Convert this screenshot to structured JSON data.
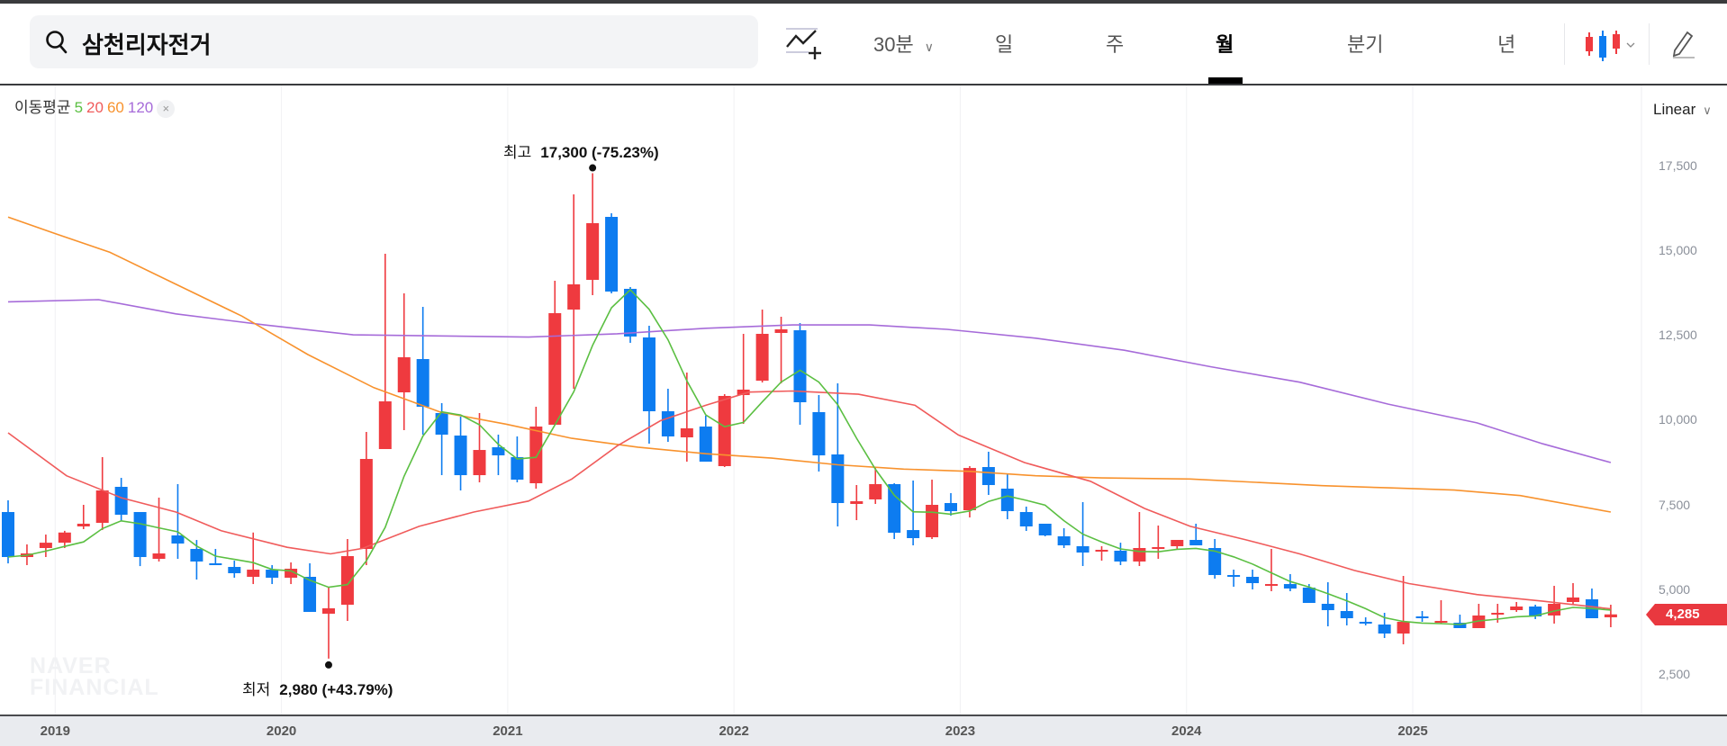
{
  "search": {
    "query": "삼천리자전거"
  },
  "toolbar": {
    "interval": "30분",
    "chevron": "⌄",
    "periods": [
      "일",
      "주",
      "월",
      "분기",
      "년"
    ],
    "active_period": "월"
  },
  "legend": {
    "label": "이동평균",
    "ma5": "5",
    "ma20": "20",
    "ma60": "60",
    "ma120": "120",
    "close": "×"
  },
  "scale": {
    "label": "Linear",
    "chevron": "⌄"
  },
  "annotations": {
    "high_label": "최고",
    "high_value": "17,300 (-75.23%)",
    "low_label": "최저",
    "low_value": "2,980 (+43.79%)"
  },
  "watermark": "NAVER FINANCIAL",
  "current_price": "4,285",
  "colors": {
    "up": "#ef3a3f",
    "down": "#0d7cf0",
    "ma5": "#5bbf42",
    "ma20": "#f05b5b",
    "ma60": "#f8922d",
    "ma120": "#a66bd9"
  },
  "chart_data": {
    "type": "candlestick",
    "interval": "monthly",
    "y_ticks": [
      "17,500",
      "15,000",
      "12,500",
      "10,000",
      "7,500",
      "5,000",
      "2,500"
    ],
    "y_tick_values": [
      17500,
      15000,
      12500,
      10000,
      7500,
      5000,
      2500
    ],
    "x_ticks": [
      {
        "label": "2019",
        "month": "2019-01"
      },
      {
        "label": "2020",
        "month": "2020-01"
      },
      {
        "label": "2021",
        "month": "2021-01"
      },
      {
        "label": "2022",
        "month": "2022-01"
      },
      {
        "label": "2023",
        "month": "2023-01"
      },
      {
        "label": "2024",
        "month": "2024-01"
      },
      {
        "label": "2025",
        "month": "2025-01"
      }
    ],
    "candle_fields": [
      "month",
      "open",
      "high",
      "low",
      "close"
    ],
    "candles": [
      [
        "2018-10",
        7305,
        7650,
        5790,
        5977
      ],
      [
        "2018-11",
        5977,
        6350,
        5738,
        6083
      ],
      [
        "2018-12",
        6243,
        6640,
        5977,
        6400
      ],
      [
        "2019-01",
        6400,
        6750,
        6243,
        6700
      ],
      [
        "2019-02",
        6880,
        7517,
        6800,
        6960
      ],
      [
        "2019-03",
        6986,
        8924,
        6773,
        7942
      ],
      [
        "2019-04",
        8048,
        8313,
        7040,
        7225
      ],
      [
        "2019-05",
        7305,
        7305,
        5710,
        5977
      ],
      [
        "2019-06",
        5924,
        7730,
        5845,
        6083
      ],
      [
        "2019-07",
        6615,
        8128,
        5924,
        6375
      ],
      [
        "2019-08",
        6216,
        6480,
        5313,
        5845
      ],
      [
        "2019-09",
        5792,
        6216,
        5738,
        5738
      ],
      [
        "2019-10",
        5685,
        5870,
        5367,
        5500
      ],
      [
        "2019-11",
        5393,
        6700,
        5180,
        5605
      ],
      [
        "2019-12",
        5605,
        5738,
        5180,
        5367
      ],
      [
        "2020-01",
        5367,
        5818,
        5180,
        5632
      ],
      [
        "2020-02",
        5393,
        5792,
        4358,
        4358
      ],
      [
        "2020-03",
        4305,
        5100,
        2980,
        4464
      ],
      [
        "2020-04",
        4570,
        6508,
        4092,
        6004
      ],
      [
        "2020-05",
        6216,
        9668,
        5738,
        8871
      ],
      [
        "2020-06",
        9163,
        14925,
        9163,
        10570
      ],
      [
        "2020-07",
        10836,
        13757,
        9720,
        11871
      ],
      [
        "2020-08",
        11818,
        13358,
        9588,
        10411
      ],
      [
        "2020-09",
        10225,
        10517,
        8393,
        9588
      ],
      [
        "2020-10",
        9561,
        10119,
        7942,
        8393
      ],
      [
        "2020-11",
        8393,
        10225,
        8181,
        9136
      ],
      [
        "2020-12",
        9216,
        9588,
        8393,
        8977
      ],
      [
        "2021-01",
        8924,
        9535,
        8181,
        8260
      ],
      [
        "2021-02",
        8154,
        10411,
        7995,
        9827
      ],
      [
        "2021-03",
        9880,
        14128,
        9880,
        13172
      ],
      [
        "2021-04",
        13278,
        16677,
        10942,
        14022
      ],
      [
        "2021-05",
        14155,
        17300,
        13703,
        15827
      ],
      [
        "2021-06",
        16013,
        16120,
        13757,
        13810
      ],
      [
        "2021-07",
        13890,
        13943,
        12297,
        12483
      ],
      [
        "2021-08",
        12456,
        12801,
        9322,
        10278
      ],
      [
        "2021-09",
        10278,
        10942,
        9375,
        9535
      ],
      [
        "2021-10",
        9508,
        11420,
        8791,
        9774
      ],
      [
        "2021-11",
        9827,
        10146,
        8791,
        8791
      ],
      [
        "2021-12",
        8659,
        10783,
        8632,
        10730
      ],
      [
        "2022-01",
        10756,
        12562,
        9906,
        10916
      ],
      [
        "2022-02",
        11180,
        13278,
        11127,
        12562
      ],
      [
        "2022-03",
        12589,
        13066,
        11100,
        12695
      ],
      [
        "2022-04",
        12668,
        12880,
        9880,
        10544
      ],
      [
        "2022-05",
        10252,
        10756,
        8500,
        8977
      ],
      [
        "2022-06",
        9004,
        11100,
        6880,
        7570
      ],
      [
        "2022-07",
        7544,
        8101,
        7066,
        7623
      ],
      [
        "2022-08",
        7677,
        8605,
        7544,
        8128
      ],
      [
        "2022-09",
        8128,
        8154,
        6508,
        6694
      ],
      [
        "2022-10",
        6773,
        8234,
        6322,
        6535
      ],
      [
        "2022-11",
        6561,
        8260,
        6508,
        7517
      ],
      [
        "2022-12",
        7570,
        7862,
        7199,
        7331
      ],
      [
        "2023-01",
        7358,
        8659,
        7146,
        8605
      ],
      [
        "2023-02",
        8632,
        9084,
        7809,
        8101
      ],
      [
        "2023-03",
        7995,
        8420,
        7093,
        7331
      ],
      [
        "2023-04",
        7305,
        7464,
        6747,
        6880
      ],
      [
        "2023-05",
        6960,
        6960,
        6588,
        6615
      ],
      [
        "2023-06",
        6588,
        6827,
        6243,
        6322
      ],
      [
        "2023-07",
        6296,
        7597,
        5712,
        6110
      ],
      [
        "2023-08",
        6163,
        6296,
        5870,
        6190
      ],
      [
        "2023-09",
        6163,
        6400,
        5738,
        5845
      ],
      [
        "2023-10",
        5845,
        7305,
        5712,
        6243
      ],
      [
        "2023-11",
        6216,
        6906,
        5924,
        6270
      ],
      [
        "2023-12",
        6296,
        6482,
        6190,
        6482
      ],
      [
        "2024-01",
        6482,
        6960,
        6322,
        6322
      ],
      [
        "2024-02",
        6243,
        6508,
        5340,
        5446
      ],
      [
        "2024-03",
        5446,
        5605,
        5100,
        5393
      ],
      [
        "2024-04",
        5393,
        5605,
        5022,
        5207
      ],
      [
        "2024-05",
        5154,
        6216,
        4968,
        5180
      ],
      [
        "2024-06",
        5180,
        5473,
        4968,
        5048
      ],
      [
        "2024-07",
        5075,
        5180,
        4623,
        4623
      ],
      [
        "2024-08",
        4597,
        5233,
        3933,
        4410
      ],
      [
        "2024-09",
        4384,
        4915,
        3960,
        4172
      ],
      [
        "2024-10",
        4066,
        4199,
        3960,
        4013
      ],
      [
        "2024-11",
        3986,
        4331,
        3588,
        3720
      ],
      [
        "2024-12",
        3720,
        5420,
        3402,
        4066
      ],
      [
        "2025-01",
        4225,
        4384,
        4066,
        4172
      ],
      [
        "2025-02",
        4039,
        4703,
        4013,
        4092
      ],
      [
        "2025-03",
        4039,
        4278,
        3880,
        3880
      ],
      [
        "2025-04",
        3880,
        4597,
        3880,
        4252
      ],
      [
        "2025-05",
        4278,
        4597,
        4039,
        4331
      ],
      [
        "2025-06",
        4411,
        4650,
        4358,
        4517
      ],
      [
        "2025-07",
        4517,
        4570,
        4146,
        4225
      ],
      [
        "2025-08",
        4252,
        5127,
        4013,
        4597
      ],
      [
        "2025-09",
        4650,
        5207,
        4570,
        4783
      ],
      [
        "2025-10",
        4730,
        5048,
        4172,
        4172
      ],
      [
        "2025-11",
        4199,
        4570,
        3907,
        4285
      ]
    ],
    "ma_point_fields": [
      "candle_index",
      "value"
    ],
    "ma20": [
      [
        0,
        9642
      ],
      [
        3.1,
        8376
      ],
      [
        6,
        7727
      ],
      [
        8.9,
        7305
      ],
      [
        11.3,
        6752
      ],
      [
        14.8,
        6265
      ],
      [
        17.1,
        6070
      ],
      [
        18.8,
        6233
      ],
      [
        21.8,
        6883
      ],
      [
        24.7,
        7305
      ],
      [
        27.6,
        7630
      ],
      [
        29.9,
        8280
      ],
      [
        32.3,
        9253
      ],
      [
        34.6,
        10000
      ],
      [
        37,
        10454
      ],
      [
        39.3,
        10844
      ],
      [
        41.6,
        10876
      ],
      [
        45.1,
        10779
      ],
      [
        48.1,
        10454
      ],
      [
        50.4,
        9577
      ],
      [
        53.9,
        8766
      ],
      [
        57.4,
        8214
      ],
      [
        60.3,
        7402
      ],
      [
        62.7,
        6883
      ],
      [
        65.6,
        6493
      ],
      [
        68.5,
        6070
      ],
      [
        71.4,
        5583
      ],
      [
        74.3,
        5194
      ],
      [
        77.9,
        4870
      ],
      [
        81.4,
        4675
      ],
      [
        85,
        4447
      ]
    ],
    "ma60": [
      [
        0,
        16006
      ],
      [
        2.5,
        15520
      ],
      [
        5.4,
        14967
      ],
      [
        8.9,
        14025
      ],
      [
        12.4,
        13084
      ],
      [
        15.9,
        11950
      ],
      [
        19.4,
        10974
      ],
      [
        22.9,
        10260
      ],
      [
        26.4,
        9900
      ],
      [
        29.9,
        9480
      ],
      [
        33.4,
        9220
      ],
      [
        37,
        9025
      ],
      [
        40.5,
        8895
      ],
      [
        44,
        8700
      ],
      [
        47.5,
        8570
      ],
      [
        51,
        8506
      ],
      [
        54.5,
        8376
      ],
      [
        58,
        8311
      ],
      [
        62.7,
        8280
      ],
      [
        66.2,
        8181
      ],
      [
        69.7,
        8083
      ],
      [
        73.2,
        8018
      ],
      [
        76.7,
        7953
      ],
      [
        80.2,
        7790
      ],
      [
        85,
        7305
      ]
    ],
    "ma120": [
      [
        0,
        13506
      ],
      [
        4.8,
        13570
      ],
      [
        8.9,
        13150
      ],
      [
        13.6,
        12825
      ],
      [
        18.3,
        12532
      ],
      [
        22.9,
        12500
      ],
      [
        27.6,
        12467
      ],
      [
        32.3,
        12565
      ],
      [
        37,
        12727
      ],
      [
        41.6,
        12825
      ],
      [
        45.7,
        12825
      ],
      [
        49.8,
        12695
      ],
      [
        54.5,
        12435
      ],
      [
        59.2,
        12078
      ],
      [
        63.8,
        11590
      ],
      [
        68.5,
        11136
      ],
      [
        73.2,
        10487
      ],
      [
        77.9,
        9935
      ],
      [
        81.4,
        9318
      ],
      [
        85,
        8766
      ]
    ],
    "ma5": "computed from closes",
    "high": {
      "value": 17300,
      "month": "2021-05"
    },
    "low": {
      "value": 2980,
      "month": "2020-03"
    },
    "last": 4285
  }
}
